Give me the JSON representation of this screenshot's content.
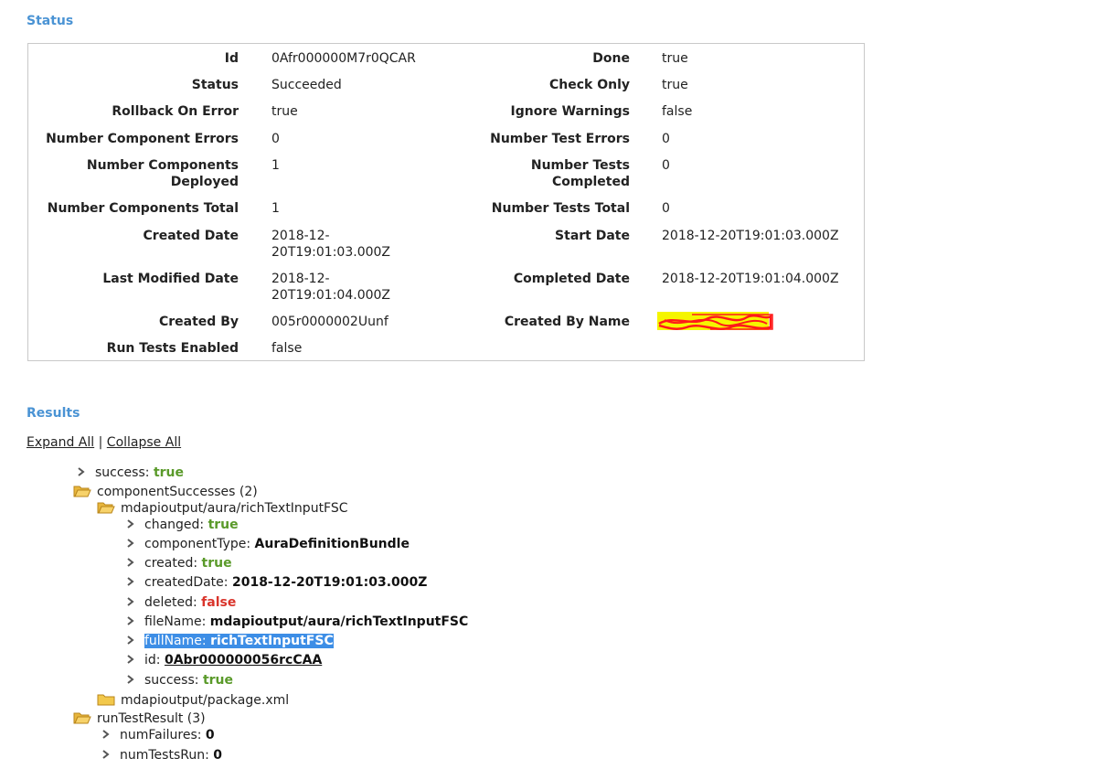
{
  "status": {
    "title": "Status",
    "rows": [
      {
        "l1": "Id",
        "v1": "0Afr000000M7r0QCAR",
        "l2": "Done",
        "v2": "true"
      },
      {
        "l1": "Status",
        "v1": "Succeeded",
        "l2": "Check Only",
        "v2": "true"
      },
      {
        "l1": "Rollback On Error",
        "v1": "true",
        "l2": "Ignore Warnings",
        "v2": "false"
      },
      {
        "l1": "Number Component Errors",
        "v1": "0",
        "l2": "Number Test Errors",
        "v2": "0"
      },
      {
        "l1a": "Number Components",
        "l1b": "Deployed",
        "v1": "1",
        "l2a": "Number Tests",
        "l2b": "Completed",
        "v2": "0"
      },
      {
        "l1": "Number Components Total",
        "v1": "1",
        "l2": "Number Tests Total",
        "v2": "0"
      },
      {
        "l1": "Created Date",
        "v1a": "2018-12-",
        "v1b": "20T19:01:03.000Z",
        "l2": "Start Date",
        "v2": "2018-12-20T19:01:03.000Z"
      },
      {
        "l1": "Last Modified Date",
        "v1a": "2018-12-",
        "v1b": "20T19:01:04.000Z",
        "l2": "Completed Date",
        "v2": "2018-12-20T19:01:04.000Z"
      },
      {
        "l1": "Created By",
        "v1": "005r0000002Uunf",
        "l2": "Created By Name",
        "v2": ""
      },
      {
        "l1": "Run Tests Enabled",
        "v1": "false"
      }
    ]
  },
  "results": {
    "title": "Results",
    "expand_all": "Expand All",
    "separator": "|",
    "collapse_all": "Collapse All",
    "tree": {
      "success_key": "success: ",
      "success_val": "true",
      "component_successes": "componentSuccesses (2)",
      "bundle_path": "mdapioutput/aura/richTextInputFSC",
      "changed_key": "changed: ",
      "changed_val": "true",
      "component_type_key": "componentType: ",
      "component_type_val": "AuraDefinitionBundle",
      "created_key": "created: ",
      "created_val": "true",
      "created_date_key": "createdDate: ",
      "created_date_val": "2018-12-20T19:01:03.000Z",
      "deleted_key": "deleted: ",
      "deleted_val": "false",
      "file_name_key": "fileName: ",
      "file_name_val": "mdapioutput/aura/richTextInputFSC",
      "full_name_key": "fullName: ",
      "full_name_val": "richTextInputFSC",
      "id_key": "id: ",
      "id_val": "0Abr000000056rcCAA",
      "inner_success_key": "success: ",
      "inner_success_val": "true",
      "package_xml": "mdapioutput/package.xml",
      "run_test_result": "runTestResult (3)",
      "num_failures_key": "numFailures: ",
      "num_failures_val": "0",
      "num_tests_run_key": "numTestsRun: ",
      "num_tests_run_val": "0"
    }
  },
  "icons": {
    "arrow": "chevron-right-icon",
    "folder_open": "folder-open-icon",
    "folder_closed": "folder-closed-icon"
  },
  "colors": {
    "section_title": "#4a93d4",
    "value_true": "#5a9a2a",
    "value_false": "#d9342b",
    "highlight": "#3d8ee6",
    "redaction_fill": "#f5f500",
    "redaction_scribble": "#ff1a1a"
  }
}
